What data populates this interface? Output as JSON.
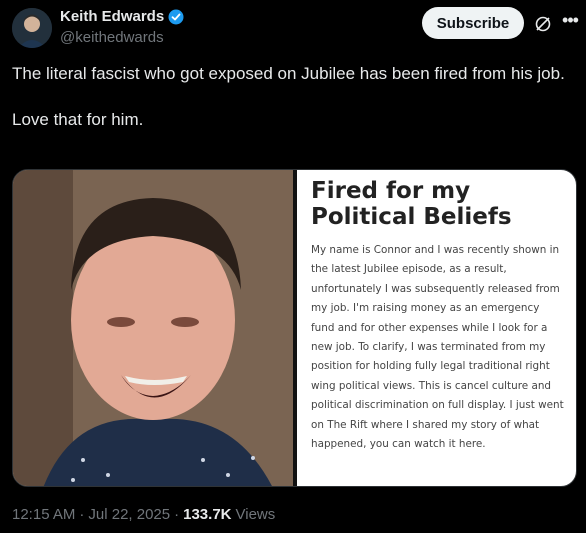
{
  "author": {
    "name": "Keith Edwards",
    "handle": "@keithedwards",
    "verified_color": "#1d9bf0"
  },
  "actions": {
    "subscribe_label": "Subscribe",
    "grok_icon": "grok-icon",
    "more_icon": "more-icon"
  },
  "tweet": {
    "line1": "The literal fascist who got exposed on Jubilee has been fired from his job.",
    "line2": "Love that for him."
  },
  "media": {
    "doc_title": "Fired for my Political Beliefs",
    "doc_body": "My name is Connor and I was recently shown in the latest Jubilee episode, as a result, unfortunately I was subsequently released from my job. I'm raising money as an emergency fund and for other expenses while I look for a new job. To clarify, I was terminated from my position for holding fully legal traditional right wing political views. This is cancel culture and political discrimination on full display. I just went on The Rift where I shared my story of what happened, you can watch it here."
  },
  "meta": {
    "time": "12:15 AM",
    "sep1": "·",
    "date": "Jul 22, 2025",
    "sep2": "·",
    "views_count": "133.7K",
    "views_label": "Views"
  }
}
